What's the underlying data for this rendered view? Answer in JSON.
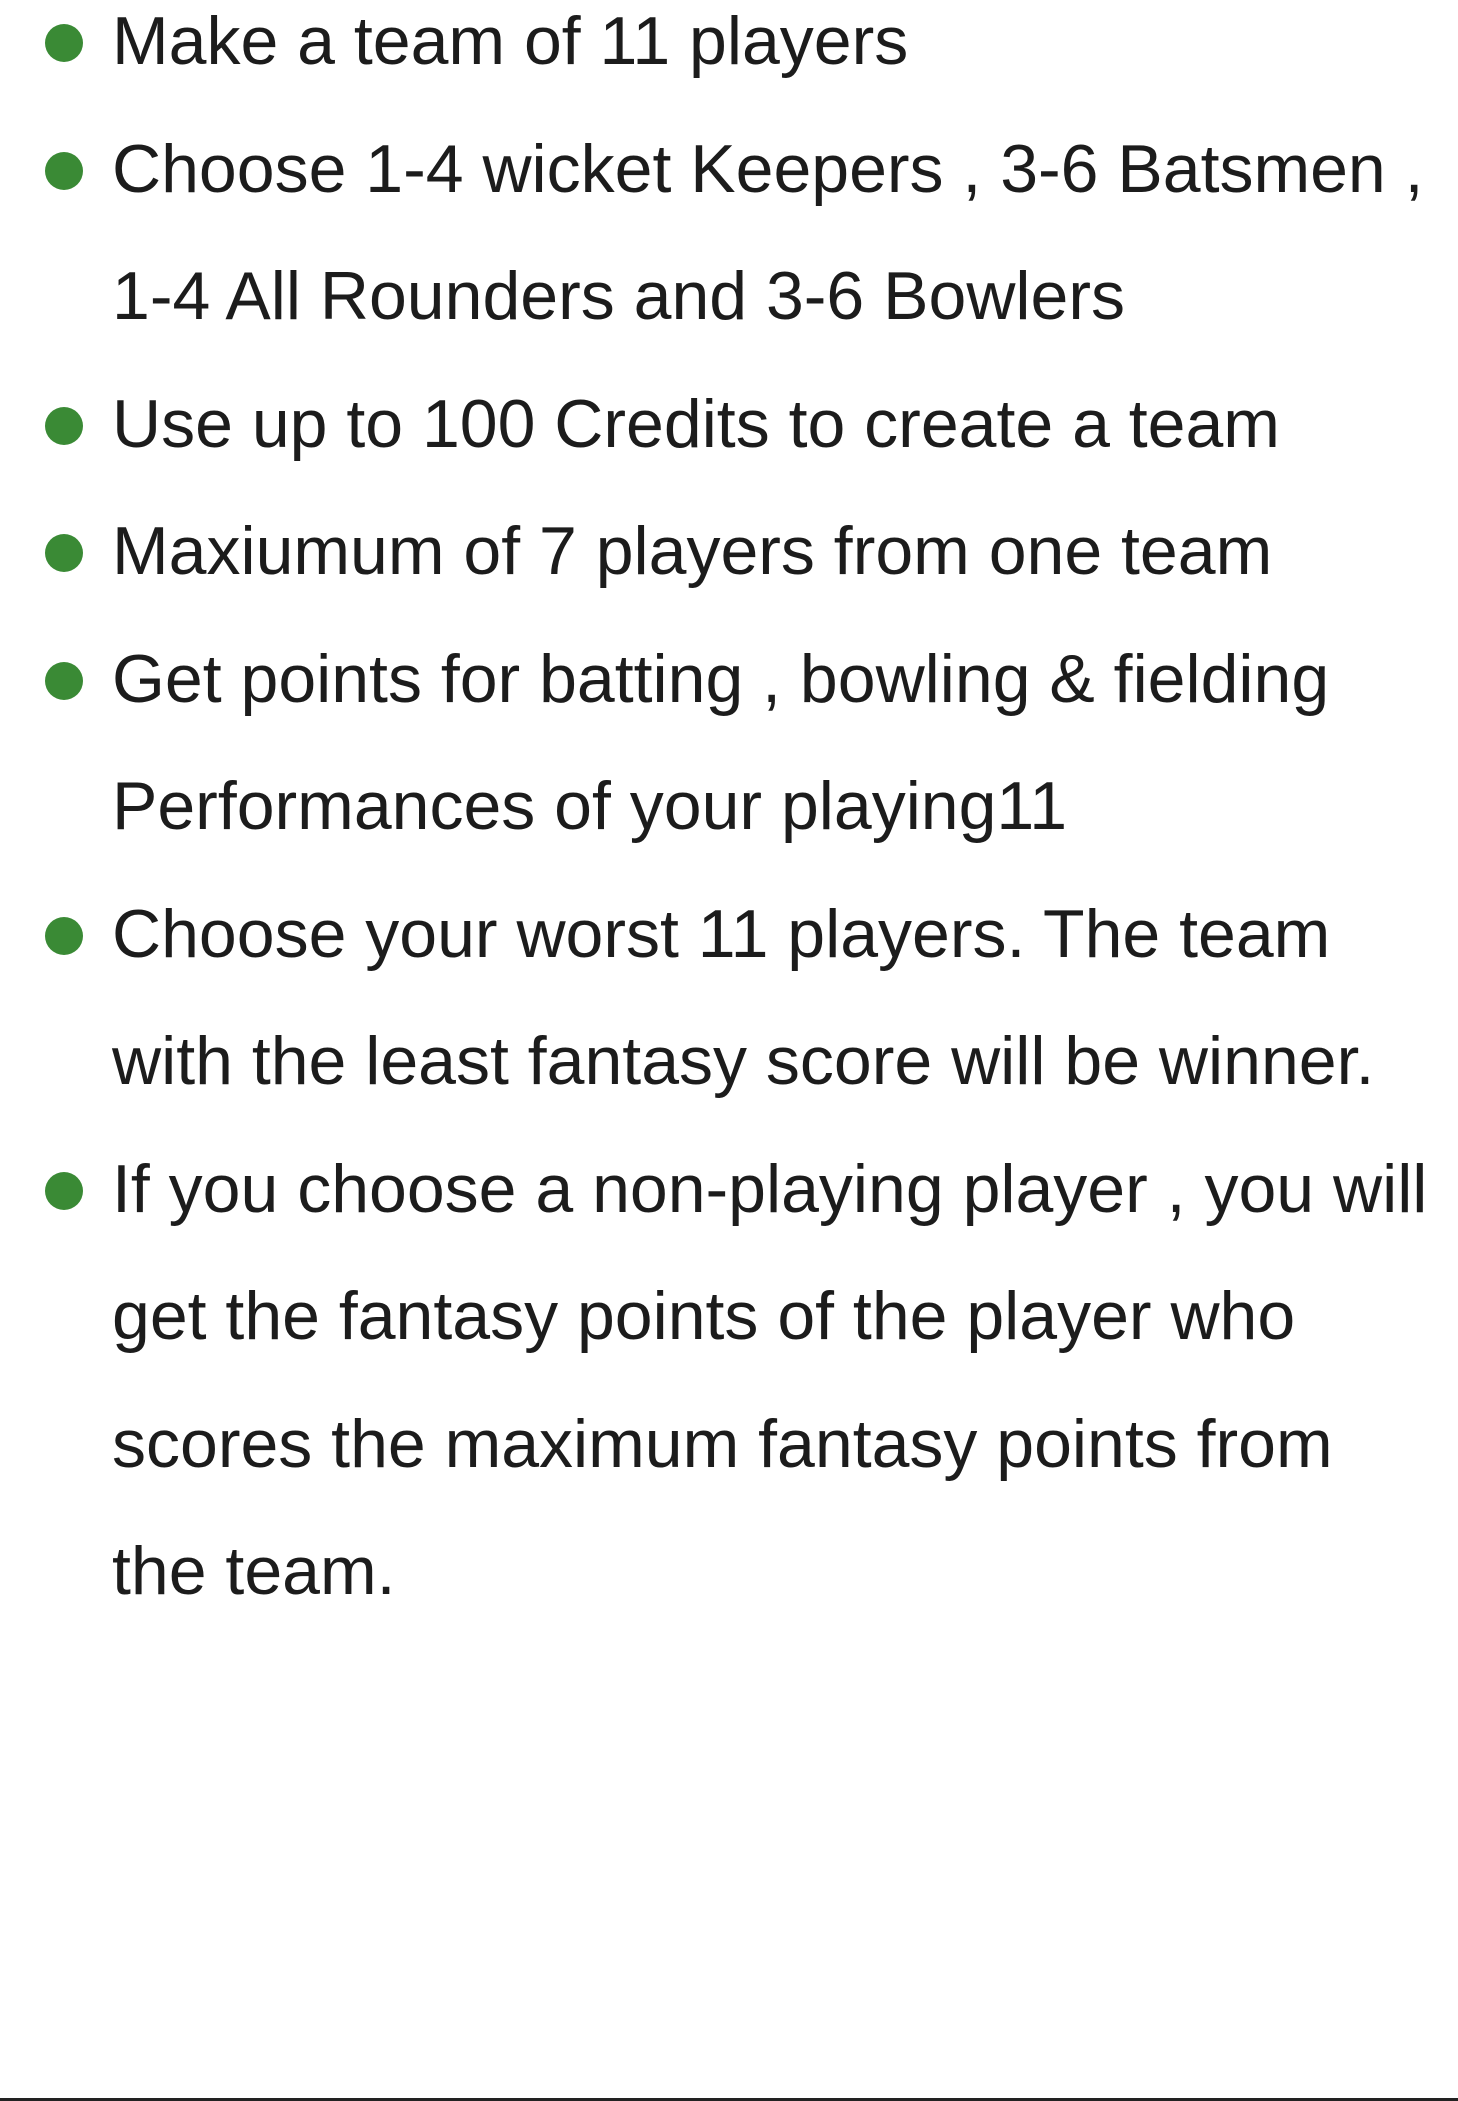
{
  "colors": {
    "bullet": "#3a8a35",
    "text": "#1c1c1c",
    "background": "#ffffff"
  },
  "rules": [
    "Make a team of 11 players",
    "Choose 1-4 wicket Keepers , 3-6 Batsmen , 1-4 All Rounders and 3-6 Bowlers",
    "Use up to 100 Credits to create a team",
    "Maxiumum of 7 players from one team",
    "Get points for batting , bowling & fielding Performances of your playing11",
    "Choose your worst 11 players. The team with the least fantasy score will be winner.",
    "If you choose a non-playing player , you will get the fantasy points of the player who scores the maximum fantasy points from the team."
  ]
}
